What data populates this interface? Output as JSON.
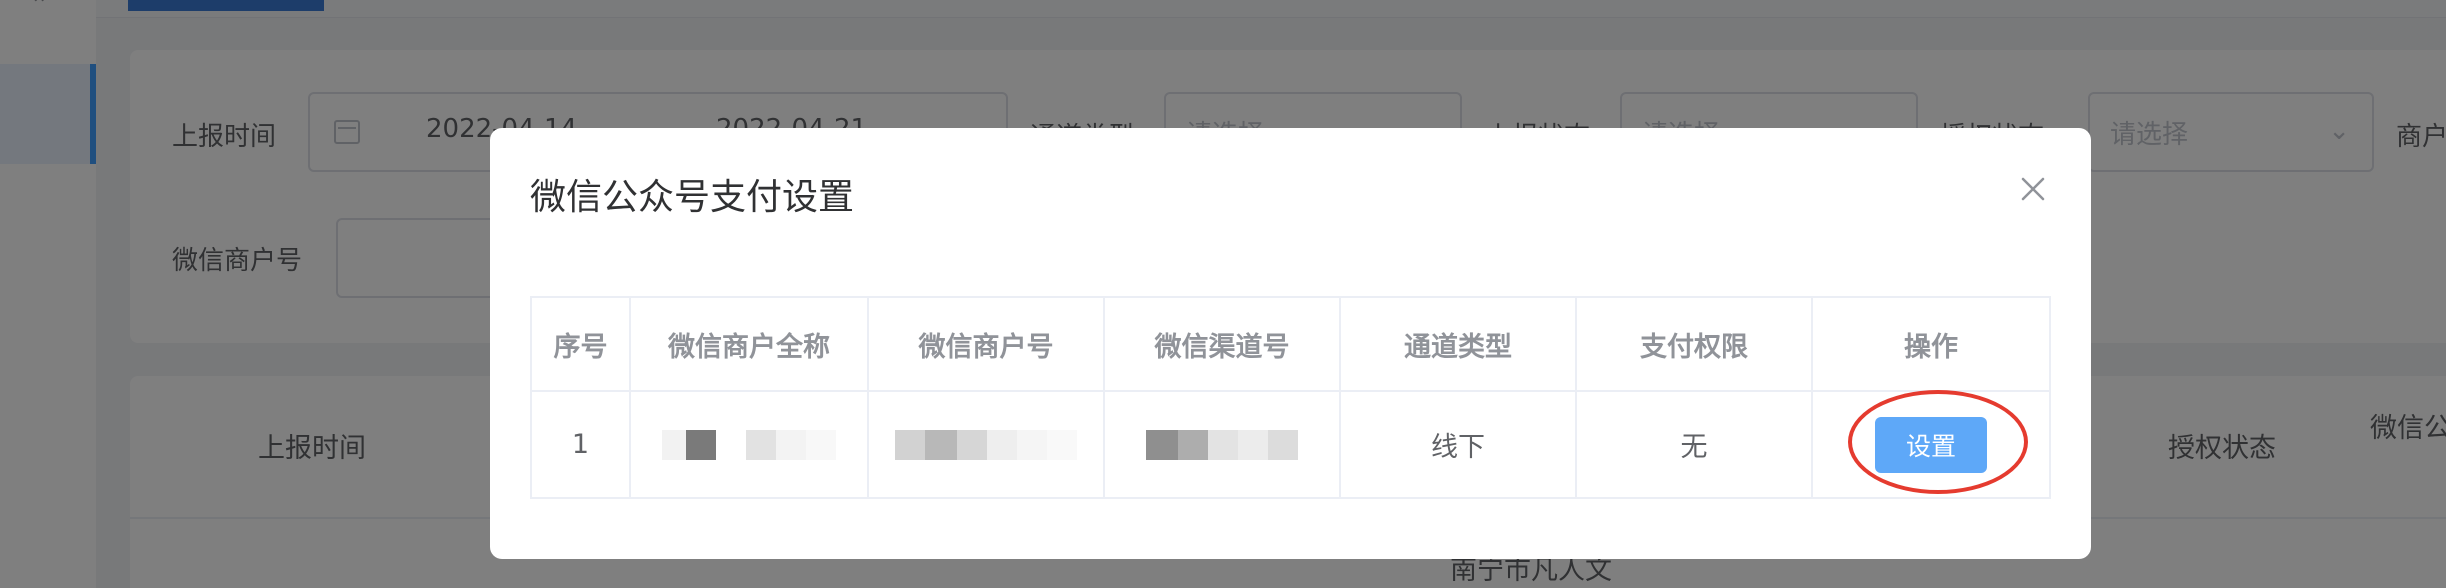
{
  "filters": {
    "report_time_label": "上报时间",
    "date_start": "2022-04-14",
    "date_end": "2022-04-21",
    "channel_type_label": "通道类型",
    "channel_type_placeholder": "请选择",
    "report_status_label": "上报状态",
    "report_status_placeholder": "请选择",
    "auth_status_label": "授权状态",
    "auth_status_placeholder": "请选择",
    "merchant_label": "商户",
    "wechat_merchant_no_label": "微信商户号"
  },
  "background_table": {
    "headers": [
      "上报时间",
      "授权状态",
      "微信公"
    ],
    "first_cell": "南宁市凡人文"
  },
  "dialog": {
    "title": "微信公众号支付设置",
    "columns": [
      "序号",
      "微信商户全称",
      "微信商户号",
      "微信渠道号",
      "通道类型",
      "支付权限",
      "操作"
    ],
    "rows": [
      {
        "index": "1",
        "channel_type": "线下",
        "pay_permission": "无",
        "action": "设置"
      }
    ]
  },
  "icons": {
    "close": "close-icon",
    "calendar": "calendar-icon",
    "dropdown": "chevron-down-icon"
  },
  "colors": {
    "primary": "#5ea8f8",
    "annotation": "#e53b2f",
    "overlay": "rgba(0,0,0,0.5)"
  }
}
